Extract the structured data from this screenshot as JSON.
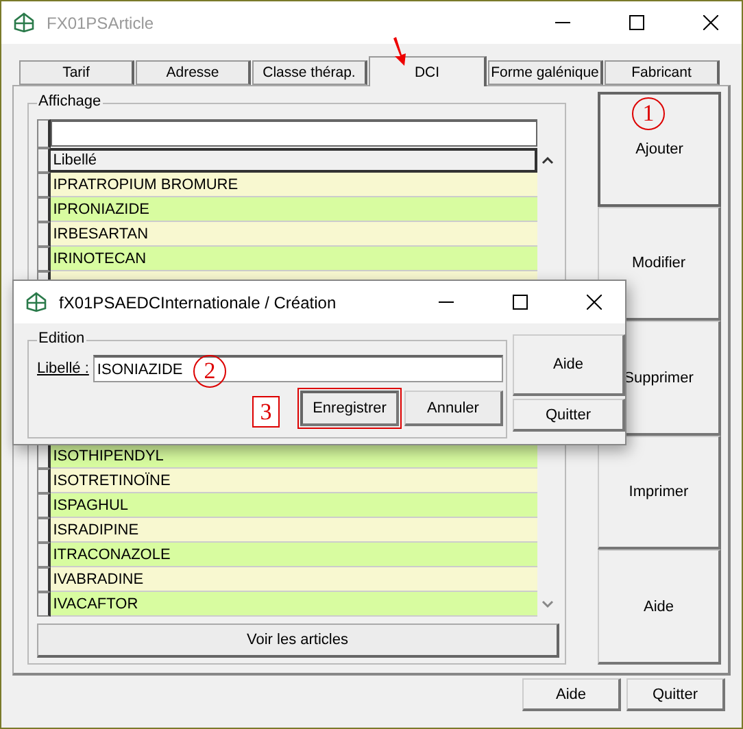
{
  "window": {
    "title": "FX01PSArticle"
  },
  "tabs": [
    {
      "label": "Tarif",
      "selected": false
    },
    {
      "label": "Adresse",
      "selected": false
    },
    {
      "label": "Classe thérap.",
      "selected": false
    },
    {
      "label": "DCI",
      "selected": true
    },
    {
      "label": "Forme galénique",
      "selected": false
    },
    {
      "label": "Fabricant",
      "selected": false
    }
  ],
  "display_group": {
    "title": "Affichage",
    "column": "Libellé",
    "rows_above": [
      "IPRATROPIUM BROMURE",
      "IPRONIAZIDE",
      "IRBESARTAN",
      "IRINOTECAN"
    ],
    "rows_below": [
      "ISOTHIPENDYL",
      "ISOTRETINOÏNE",
      "ISPAGHUL",
      "ISRADIPINE",
      "ITRACONAZOLE",
      "IVABRADINE",
      "IVACAFTOR"
    ],
    "view_button": "Voir les articles"
  },
  "side_buttons": [
    "Ajouter",
    "Modifier",
    "Supprimer",
    "Imprimer",
    "Aide"
  ],
  "footer_buttons": [
    "Aide",
    "Quitter"
  ],
  "dialog": {
    "title": "fX01PSAEDCInternationale / Création",
    "group": "Edition",
    "field_label": "Libellé :",
    "field_value": "ISONIAZIDE",
    "buttons": [
      {
        "label": "Enregistrer",
        "focused": true
      },
      {
        "label": "Annuler",
        "focused": false
      }
    ],
    "side_buttons": [
      "Aide",
      "Quitter"
    ]
  },
  "annotations": [
    "1",
    "2",
    "3"
  ]
}
